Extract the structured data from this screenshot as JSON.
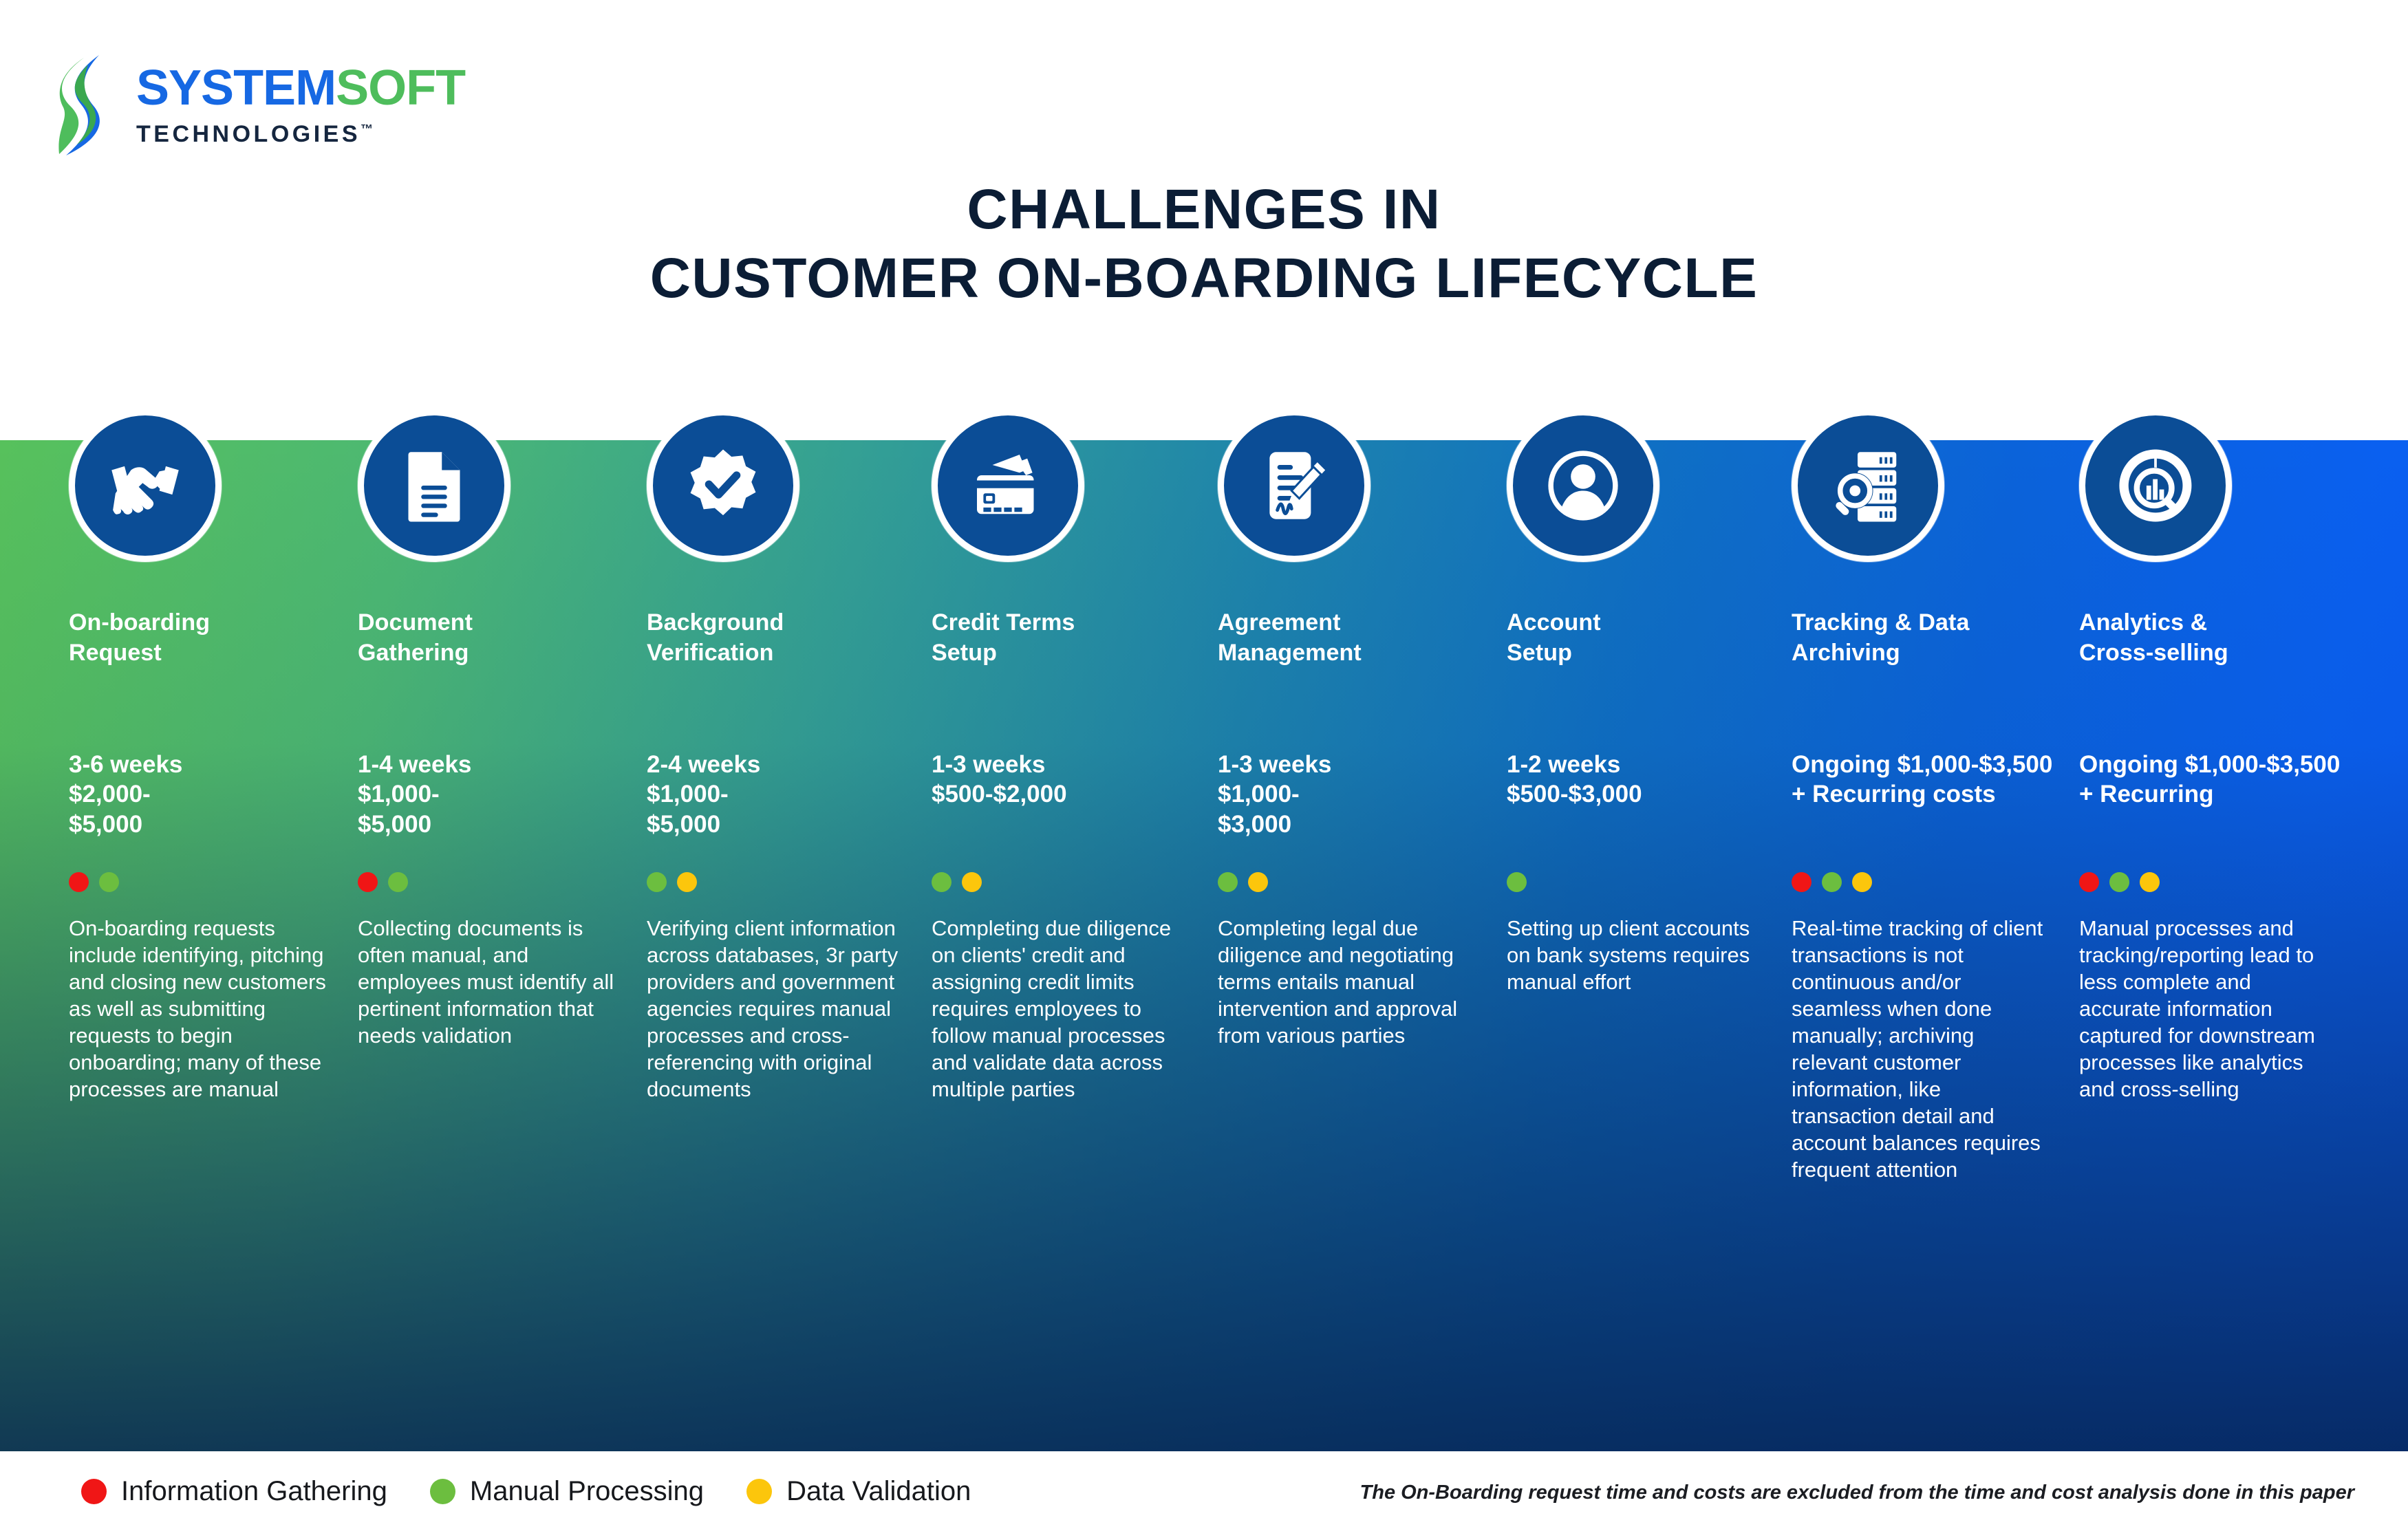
{
  "brand": {
    "logo_mark": "stylized-s-swoosh",
    "name_part1": "SYSTEM",
    "name_part2": "SOFT",
    "tagline": "TECHNOLOGIES",
    "trademark": "™",
    "color_blue": "#1668e3",
    "color_green": "#4ebd5c",
    "color_navy": "#15263f"
  },
  "header": {
    "title_line1": "CHALLENGES IN",
    "title_line2": "CUSTOMER ON-BOARDING LIFECYCLE"
  },
  "palette": {
    "circle_fill": "#0b4d96",
    "dot_red": "#f01616",
    "dot_green": "#6cbe3f",
    "dot_yellow": "#fcc60c",
    "gradient_start": "#57c15c",
    "gradient_mid": "#1d83ad",
    "gradient_end": "#0a5cf5"
  },
  "legend": {
    "items": [
      {
        "label": "Information Gathering",
        "color": "#f01616",
        "key": "red"
      },
      {
        "label": "Manual Processing",
        "color": "#6cbe3f",
        "key": "green"
      },
      {
        "label": "Data Validation",
        "color": "#fcc60c",
        "key": "yellow"
      }
    ]
  },
  "footnote": "The On-Boarding request time and costs are excluded from the time and cost analysis done in this paper",
  "stages": [
    {
      "icon": "handshake-icon",
      "title": "On-boarding\nRequest",
      "cost": "3-6 weeks\n$2,000-\n$5,000",
      "duration": "3-6 weeks",
      "cost_range": "$2,000-$5,000",
      "dots": [
        "red",
        "green"
      ],
      "description": "On-boarding requests include identifying, pitching and closing new customers as well as submitting requests to begin onboarding; many of these processes are manual"
    },
    {
      "icon": "document-icon",
      "title": "Document\nGathering",
      "cost": "1-4 weeks\n$1,000-\n$5,000",
      "duration": "1-4 weeks",
      "cost_range": "$1,000-$5,000",
      "dots": [
        "red",
        "green"
      ],
      "description": "Collecting documents is often manual, and employees must identify all pertinent information that needs validation"
    },
    {
      "icon": "verified-badge-icon",
      "title": "Background\nVerification",
      "cost": "2-4 weeks\n$1,000-\n$5,000",
      "duration": "2-4 weeks",
      "cost_range": "$1,000-$5,000",
      "dots": [
        "green",
        "yellow"
      ],
      "description": "Verifying client information across databases, 3r party providers and government agencies requires manual processes and cross-referencing with original documents"
    },
    {
      "icon": "credit-card-wallet-icon",
      "title": "Credit Terms\nSetup",
      "cost": "1-3 weeks\n$500-$2,000",
      "duration": "1-3 weeks",
      "cost_range": "$500-$2,000",
      "dots": [
        "green",
        "yellow"
      ],
      "description": "Completing due diligence on clients' credit and assigning credit limits requires employees to follow manual processes and validate data across multiple parties"
    },
    {
      "icon": "contract-signature-icon",
      "title": "Agreement\nManagement",
      "cost": "1-3 weeks\n$1,000-\n$3,000",
      "duration": "1-3 weeks",
      "cost_range": "$1,000-$3,000",
      "dots": [
        "green",
        "yellow"
      ],
      "description": "Completing legal due diligence and negotiating terms entails manual intervention and approval from various parties"
    },
    {
      "icon": "user-account-icon",
      "title": "Account\nSetup",
      "cost": "1-2 weeks\n$500-$3,000",
      "duration": "1-2 weeks",
      "cost_range": "$500-$3,000",
      "dots": [
        "green"
      ],
      "description": "Setting up client accounts on bank systems requires manual effort"
    },
    {
      "icon": "server-search-icon",
      "title": "Tracking & Data\nArchiving",
      "cost": "Ongoing $1,000-$3,500 + Recurring costs",
      "duration": "Ongoing",
      "cost_range": "$1,000-$3,500 + Recurring costs",
      "dots": [
        "red",
        "green",
        "yellow"
      ],
      "description": "Real-time tracking of client transactions is not continuous and/or seamless when done manually; archiving relevant customer information, like transaction detail and account balances requires frequent attention"
    },
    {
      "icon": "analytics-chart-search-icon",
      "title": "Analytics &\nCross-selling",
      "cost": "Ongoing $1,000-$3,500 + Recurring",
      "duration": "Ongoing",
      "cost_range": "$1,000-$3,500 + Recurring",
      "dots": [
        "red",
        "green",
        "yellow"
      ],
      "description": "Manual processes and tracking/reporting lead to less complete and accurate information captured for downstream processes like analytics and cross-selling"
    }
  ]
}
